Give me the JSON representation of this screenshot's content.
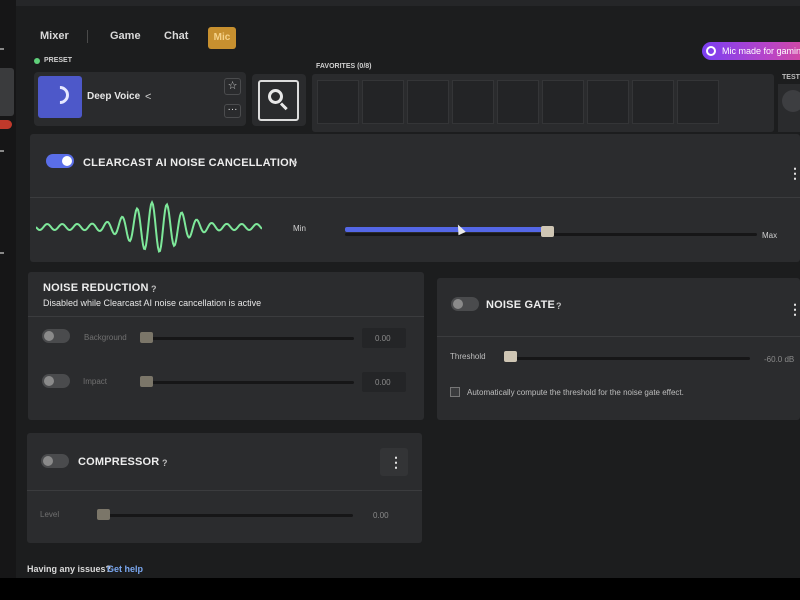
{
  "tabs": [
    {
      "label": "Mixer"
    },
    {
      "label": "Game"
    },
    {
      "label": "Chat"
    },
    {
      "label": "Mic"
    }
  ],
  "promo": {
    "label": "Mic made for gaming"
  },
  "preset": {
    "section_label": "PRESET",
    "name": "Deep Voice"
  },
  "favorites": {
    "label": "FAVORITES (0/8)"
  },
  "test": {
    "label": "TEST"
  },
  "clearcast": {
    "title": "CLEARCAST AI NOISE CANCELLATION",
    "help": "?",
    "enabled": true,
    "min_label": "Min",
    "max_label": "Max",
    "level": 0.49
  },
  "noise_reduction": {
    "title": "NOISE REDUCTION",
    "help": "?",
    "subtitle": "Disabled while Clearcast AI noise cancellation is active",
    "rows": [
      {
        "label": "Background",
        "value": "0.00"
      },
      {
        "label": "Impact",
        "value": "0.00"
      }
    ]
  },
  "noise_gate": {
    "title": "NOISE GATE",
    "help": "?",
    "enabled": false,
    "threshold_label": "Threshold",
    "threshold_value": "-60.0 dB",
    "auto_label": "Automatically compute the threshold for the noise gate effect."
  },
  "compressor": {
    "title": "COMPRESSOR",
    "help": "?",
    "enabled": false,
    "level_label": "Level",
    "level_value": "0.00"
  },
  "footer": {
    "question": "Having any issues?",
    "link": "Get help"
  },
  "colors": {
    "accent": "#5467e6",
    "mic_tab": "#c7902f",
    "waveform": "#7ee89a",
    "link": "#7aa7f0"
  }
}
